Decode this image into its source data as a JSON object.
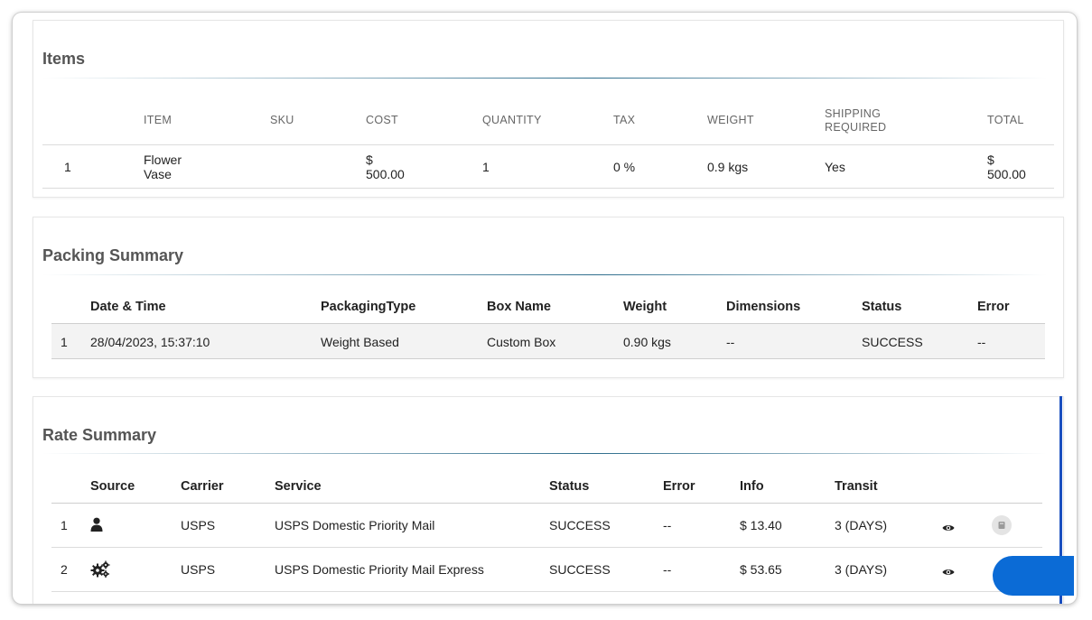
{
  "items": {
    "title": "Items",
    "headers": [
      "ITEM",
      "SKU",
      "COST",
      "QUANTITY",
      "TAX",
      "WEIGHT",
      "SHIPPING",
      "REQUIRED",
      "TOTAL"
    ],
    "row": {
      "index": "1",
      "item_line1": "Flower",
      "item_line2": "Vase",
      "sku": "",
      "cost_line1": "$",
      "cost_line2": "500.00",
      "quantity": "1",
      "tax": "0 %",
      "weight": "0.9 kgs",
      "shipping": "Yes",
      "total_line1": "$",
      "total_line2": "500.00"
    }
  },
  "packing": {
    "title": "Packing Summary",
    "headers": [
      "Date & Time",
      "PackagingType",
      "Box Name",
      "Weight",
      "Dimensions",
      "Status",
      "Error"
    ],
    "row": {
      "index": "1",
      "datetime": "28/04/2023, 15:37:10",
      "packaging_type": "Weight Based",
      "box_name": "Custom Box",
      "weight": "0.90 kgs",
      "dimensions": "--",
      "status": "SUCCESS",
      "error": "--"
    }
  },
  "rates": {
    "title": "Rate Summary",
    "headers": [
      "Source",
      "Carrier",
      "Service",
      "Status",
      "Error",
      "Info",
      "Transit"
    ],
    "rows": [
      {
        "index": "1",
        "source_icon": "user-icon",
        "carrier": "USPS",
        "service": "USPS Domestic Priority Mail",
        "status": "SUCCESS",
        "error": "--",
        "info": "$ 13.40",
        "transit": "3 (DAYS)"
      },
      {
        "index": "2",
        "source_icon": "gears-icon",
        "carrier": "USPS",
        "service": "USPS Domestic Priority Mail Express",
        "status": "SUCCESS",
        "error": "--",
        "info": "$ 53.65",
        "transit": "3 (DAYS)"
      }
    ]
  },
  "colors": {
    "accent_blue": "#0b6bd6",
    "divider": "#2f6e8d",
    "scroll_accent": "#1a4fbf"
  }
}
